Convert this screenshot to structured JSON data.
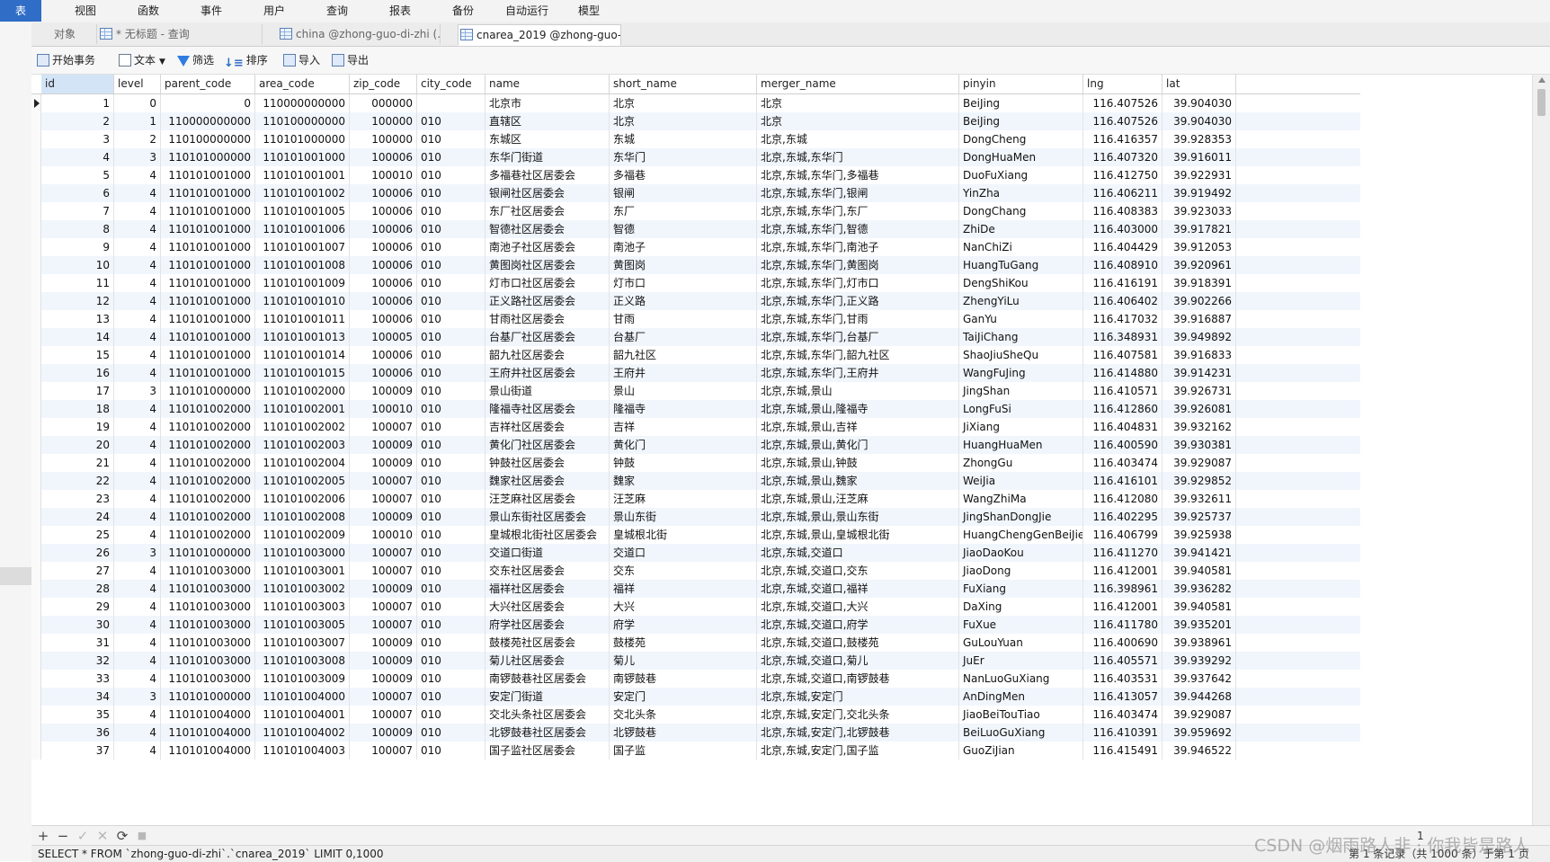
{
  "menu": [
    "表",
    "视图",
    "函数",
    "事件",
    "用户",
    "查询",
    "报表",
    "备份",
    "自动运行",
    "模型"
  ],
  "tabs": [
    {
      "label": "对象"
    },
    {
      "label": "* 无标题 - 查询"
    },
    {
      "label": "china @zhong-guo-di-zhi (..."
    },
    {
      "label": "cnarea_2019 @zhong-guo-..."
    }
  ],
  "toolbar": {
    "begin_tx": "开始事务",
    "text": "文本",
    "filter": "筛选",
    "sort": "排序",
    "import": "导入",
    "export": "导出"
  },
  "columns": [
    "id",
    "level",
    "parent_code",
    "area_code",
    "zip_code",
    "city_code",
    "name",
    "short_name",
    "merger_name",
    "pinyin",
    "lng",
    "lat"
  ],
  "rows": [
    [
      "1",
      "0",
      "0",
      "110000000000",
      "000000",
      "",
      "北京市",
      "北京",
      "北京",
      "BeiJing",
      "116.407526",
      "39.904030"
    ],
    [
      "2",
      "1",
      "110000000000",
      "110100000000",
      "100000",
      "010",
      "直辖区",
      "北京",
      "北京",
      "BeiJing",
      "116.407526",
      "39.904030"
    ],
    [
      "3",
      "2",
      "110100000000",
      "110101000000",
      "100000",
      "010",
      "东城区",
      "东城",
      "北京,东城",
      "DongCheng",
      "116.416357",
      "39.928353"
    ],
    [
      "4",
      "3",
      "110101000000",
      "110101001000",
      "100006",
      "010",
      "东华门街道",
      "东华门",
      "北京,东城,东华门",
      "DongHuaMen",
      "116.407320",
      "39.916011"
    ],
    [
      "5",
      "4",
      "110101001000",
      "110101001001",
      "100010",
      "010",
      "多福巷社区居委会",
      "多福巷",
      "北京,东城,东华门,多福巷",
      "DuoFuXiang",
      "116.412750",
      "39.922931"
    ],
    [
      "6",
      "4",
      "110101001000",
      "110101001002",
      "100006",
      "010",
      "银闸社区居委会",
      "银闸",
      "北京,东城,东华门,银闸",
      "YinZha",
      "116.406211",
      "39.919492"
    ],
    [
      "7",
      "4",
      "110101001000",
      "110101001005",
      "100006",
      "010",
      "东厂社区居委会",
      "东厂",
      "北京,东城,东华门,东厂",
      "DongChang",
      "116.408383",
      "39.923033"
    ],
    [
      "8",
      "4",
      "110101001000",
      "110101001006",
      "100006",
      "010",
      "智德社区居委会",
      "智德",
      "北京,东城,东华门,智德",
      "ZhiDe",
      "116.403000",
      "39.917821"
    ],
    [
      "9",
      "4",
      "110101001000",
      "110101001007",
      "100006",
      "010",
      "南池子社区居委会",
      "南池子",
      "北京,东城,东华门,南池子",
      "NanChiZi",
      "116.404429",
      "39.912053"
    ],
    [
      "10",
      "4",
      "110101001000",
      "110101001008",
      "100006",
      "010",
      "黄图岗社区居委会",
      "黄图岗",
      "北京,东城,东华门,黄图岗",
      "HuangTuGang",
      "116.408910",
      "39.920961"
    ],
    [
      "11",
      "4",
      "110101001000",
      "110101001009",
      "100006",
      "010",
      "灯市口社区居委会",
      "灯市口",
      "北京,东城,东华门,灯市口",
      "DengShiKou",
      "116.416191",
      "39.918391"
    ],
    [
      "12",
      "4",
      "110101001000",
      "110101001010",
      "100006",
      "010",
      "正义路社区居委会",
      "正义路",
      "北京,东城,东华门,正义路",
      "ZhengYiLu",
      "116.406402",
      "39.902266"
    ],
    [
      "13",
      "4",
      "110101001000",
      "110101001011",
      "100006",
      "010",
      "甘雨社区居委会",
      "甘雨",
      "北京,东城,东华门,甘雨",
      "GanYu",
      "116.417032",
      "39.916887"
    ],
    [
      "14",
      "4",
      "110101001000",
      "110101001013",
      "100005",
      "010",
      "台基厂社区居委会",
      "台基厂",
      "北京,东城,东华门,台基厂",
      "TaiJiChang",
      "116.348931",
      "39.949892"
    ],
    [
      "15",
      "4",
      "110101001000",
      "110101001014",
      "100006",
      "010",
      "韶九社区居委会",
      "韶九社区",
      "北京,东城,东华门,韶九社区",
      "ShaoJiuSheQu",
      "116.407581",
      "39.916833"
    ],
    [
      "16",
      "4",
      "110101001000",
      "110101001015",
      "100006",
      "010",
      "王府井社区居委会",
      "王府井",
      "北京,东城,东华门,王府井",
      "WangFuJing",
      "116.414880",
      "39.914231"
    ],
    [
      "17",
      "3",
      "110101000000",
      "110101002000",
      "100009",
      "010",
      "景山街道",
      "景山",
      "北京,东城,景山",
      "JingShan",
      "116.410571",
      "39.926731"
    ],
    [
      "18",
      "4",
      "110101002000",
      "110101002001",
      "100010",
      "010",
      "隆福寺社区居委会",
      "隆福寺",
      "北京,东城,景山,隆福寺",
      "LongFuSi",
      "116.412860",
      "39.926081"
    ],
    [
      "19",
      "4",
      "110101002000",
      "110101002002",
      "100007",
      "010",
      "吉祥社区居委会",
      "吉祥",
      "北京,东城,景山,吉祥",
      "JiXiang",
      "116.404831",
      "39.932162"
    ],
    [
      "20",
      "4",
      "110101002000",
      "110101002003",
      "100009",
      "010",
      "黄化门社区居委会",
      "黄化门",
      "北京,东城,景山,黄化门",
      "HuangHuaMen",
      "116.400590",
      "39.930381"
    ],
    [
      "21",
      "4",
      "110101002000",
      "110101002004",
      "100009",
      "010",
      "钟鼓社区居委会",
      "钟鼓",
      "北京,东城,景山,钟鼓",
      "ZhongGu",
      "116.403474",
      "39.929087"
    ],
    [
      "22",
      "4",
      "110101002000",
      "110101002005",
      "100007",
      "010",
      "魏家社区居委会",
      "魏家",
      "北京,东城,景山,魏家",
      "WeiJia",
      "116.416101",
      "39.929852"
    ],
    [
      "23",
      "4",
      "110101002000",
      "110101002006",
      "100007",
      "010",
      "汪芝麻社区居委会",
      "汪芝麻",
      "北京,东城,景山,汪芝麻",
      "WangZhiMa",
      "116.412080",
      "39.932611"
    ],
    [
      "24",
      "4",
      "110101002000",
      "110101002008",
      "100009",
      "010",
      "景山东街社区居委会",
      "景山东街",
      "北京,东城,景山,景山东街",
      "JingShanDongJie",
      "116.402295",
      "39.925737"
    ],
    [
      "25",
      "4",
      "110101002000",
      "110101002009",
      "100010",
      "010",
      "皇城根北街社区居委会",
      "皇城根北街",
      "北京,东城,景山,皇城根北街",
      "HuangChengGenBeiJie",
      "116.406799",
      "39.925938"
    ],
    [
      "26",
      "3",
      "110101000000",
      "110101003000",
      "100007",
      "010",
      "交道口街道",
      "交道口",
      "北京,东城,交道口",
      "JiaoDaoKou",
      "116.411270",
      "39.941421"
    ],
    [
      "27",
      "4",
      "110101003000",
      "110101003001",
      "100007",
      "010",
      "交东社区居委会",
      "交东",
      "北京,东城,交道口,交东",
      "JiaoDong",
      "116.412001",
      "39.940581"
    ],
    [
      "28",
      "4",
      "110101003000",
      "110101003002",
      "100009",
      "010",
      "福祥社区居委会",
      "福祥",
      "北京,东城,交道口,福祥",
      "FuXiang",
      "116.398961",
      "39.936282"
    ],
    [
      "29",
      "4",
      "110101003000",
      "110101003003",
      "100007",
      "010",
      "大兴社区居委会",
      "大兴",
      "北京,东城,交道口,大兴",
      "DaXing",
      "116.412001",
      "39.940581"
    ],
    [
      "30",
      "4",
      "110101003000",
      "110101003005",
      "100007",
      "010",
      "府学社区居委会",
      "府学",
      "北京,东城,交道口,府学",
      "FuXue",
      "116.411780",
      "39.935201"
    ],
    [
      "31",
      "4",
      "110101003000",
      "110101003007",
      "100009",
      "010",
      "鼓楼苑社区居委会",
      "鼓楼苑",
      "北京,东城,交道口,鼓楼苑",
      "GuLouYuan",
      "116.400690",
      "39.938961"
    ],
    [
      "32",
      "4",
      "110101003000",
      "110101003008",
      "100009",
      "010",
      "菊儿社区居委会",
      "菊儿",
      "北京,东城,交道口,菊儿",
      "JuEr",
      "116.405571",
      "39.939292"
    ],
    [
      "33",
      "4",
      "110101003000",
      "110101003009",
      "100009",
      "010",
      "南锣鼓巷社区居委会",
      "南锣鼓巷",
      "北京,东城,交道口,南锣鼓巷",
      "NanLuoGuXiang",
      "116.403531",
      "39.937642"
    ],
    [
      "34",
      "3",
      "110101000000",
      "110101004000",
      "100007",
      "010",
      "安定门街道",
      "安定门",
      "北京,东城,安定门",
      "AnDingMen",
      "116.413057",
      "39.944268"
    ],
    [
      "35",
      "4",
      "110101004000",
      "110101004001",
      "100007",
      "010",
      "交北头条社区居委会",
      "交北头条",
      "北京,东城,安定门,交北头条",
      "JiaoBeiTouTiao",
      "116.403474",
      "39.929087"
    ],
    [
      "36",
      "4",
      "110101004000",
      "110101004002",
      "100009",
      "010",
      "北锣鼓巷社区居委会",
      "北锣鼓巷",
      "北京,东城,安定门,北锣鼓巷",
      "BeiLuoGuXiang",
      "116.410391",
      "39.959692"
    ],
    [
      "37",
      "4",
      "110101004000",
      "110101004003",
      "100007",
      "010",
      "国子监社区居委会",
      "国子监",
      "北京,东城,安定门,国子监",
      "GuoZiJian",
      "116.415491",
      "39.946522"
    ]
  ],
  "nav": {
    "add": "+",
    "remove": "−",
    "apply": "✓",
    "cancel": "✕",
    "refresh": "⟳",
    "stop": "■",
    "page": "1"
  },
  "status": {
    "sql": "SELECT * FROM `zhong-guo-di-zhi`.`cnarea_2019` LIMIT 0,1000",
    "record": "第 1 条记录（共 1000 条）于第 1 页"
  },
  "watermark": "CSDN @烟雨路人非 · 你我皆是路人",
  "colors": {
    "accent": "#2f6dc6",
    "alt_row": "#f1f6fd",
    "selected_header": "#d4e4f7"
  },
  "icons": [
    "transaction-icon",
    "text-icon",
    "filter-icon",
    "sort-icon",
    "import-icon",
    "export-icon",
    "table-icon"
  ]
}
